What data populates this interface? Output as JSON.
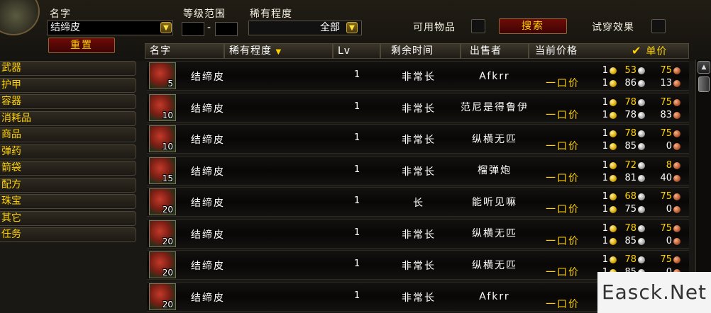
{
  "filters": {
    "name_label": "名字",
    "name_value": "结缔皮",
    "level_label": "等级范围",
    "level_dash": "-",
    "rarity_label": "稀有程度",
    "rarity_value": "全部",
    "usable_label": "可用物品",
    "search_button": "搜索",
    "preview_label": "试穿效果",
    "reset_button": "重置"
  },
  "columns": {
    "name": "名字",
    "rarity": "稀有程度",
    "lv": "Lv",
    "time": "剩余时间",
    "seller": "出售者",
    "price": "当前价格",
    "unit_price": "单价"
  },
  "categories": [
    "武器",
    "护甲",
    "容器",
    "消耗品",
    "商品",
    "弹药",
    "箭袋",
    "配方",
    "珠宝",
    "其它",
    "任务"
  ],
  "buyout_label": "一口价",
  "rows": [
    {
      "qty": "5",
      "name": "结缔皮",
      "lv": "1",
      "time": "非常长",
      "seller": "Afkrr",
      "bid": {
        "g": "1",
        "s": "53",
        "c": "75"
      },
      "buyout": {
        "g": "1",
        "s": "86",
        "c": "13"
      }
    },
    {
      "qty": "10",
      "name": "结缔皮",
      "lv": "1",
      "time": "非常长",
      "seller": "范尼是得鲁伊",
      "bid": {
        "g": "1",
        "s": "78",
        "c": "75"
      },
      "buyout": {
        "g": "1",
        "s": "78",
        "c": "83"
      }
    },
    {
      "qty": "10",
      "name": "结缔皮",
      "lv": "1",
      "time": "非常长",
      "seller": "纵横无匹",
      "bid": {
        "g": "1",
        "s": "78",
        "c": "75"
      },
      "buyout": {
        "g": "1",
        "s": "85",
        "c": "0"
      }
    },
    {
      "qty": "15",
      "name": "结缔皮",
      "lv": "1",
      "time": "非常长",
      "seller": "榴弹炮",
      "bid": {
        "g": "1",
        "s": "72",
        "c": "8"
      },
      "buyout": {
        "g": "1",
        "s": "81",
        "c": "40"
      }
    },
    {
      "qty": "20",
      "name": "结缔皮",
      "lv": "1",
      "time": "长",
      "seller": "能听见嘛",
      "bid": {
        "g": "1",
        "s": "68",
        "c": "75"
      },
      "buyout": {
        "g": "1",
        "s": "75",
        "c": "0"
      }
    },
    {
      "qty": "20",
      "name": "结缔皮",
      "lv": "1",
      "time": "非常长",
      "seller": "纵横无匹",
      "bid": {
        "g": "1",
        "s": "78",
        "c": "75"
      },
      "buyout": {
        "g": "1",
        "s": "85",
        "c": "0"
      }
    },
    {
      "qty": "20",
      "name": "结缔皮",
      "lv": "1",
      "time": "非常长",
      "seller": "纵横无匹",
      "bid": {
        "g": "1",
        "s": "78",
        "c": "75"
      },
      "buyout": {
        "g": "1",
        "s": "85",
        "c": "0"
      }
    },
    {
      "qty": "20",
      "name": "结缔皮",
      "lv": "1",
      "time": "非常长",
      "seller": "Afkrr",
      "bid": {
        "g": "",
        "s": "",
        "c": ""
      },
      "buyout": {
        "g": "",
        "s": "",
        "c": ""
      }
    }
  ],
  "watermark": "Easck.Net",
  "icons": {
    "dropdown": "dropdown-arrow-icon",
    "checkmark": "checkmark-icon",
    "sort": "sort-arrow-icon",
    "gold": "gold-coin-icon",
    "silver": "silver-coin-icon",
    "copper": "copper-coin-icon"
  }
}
